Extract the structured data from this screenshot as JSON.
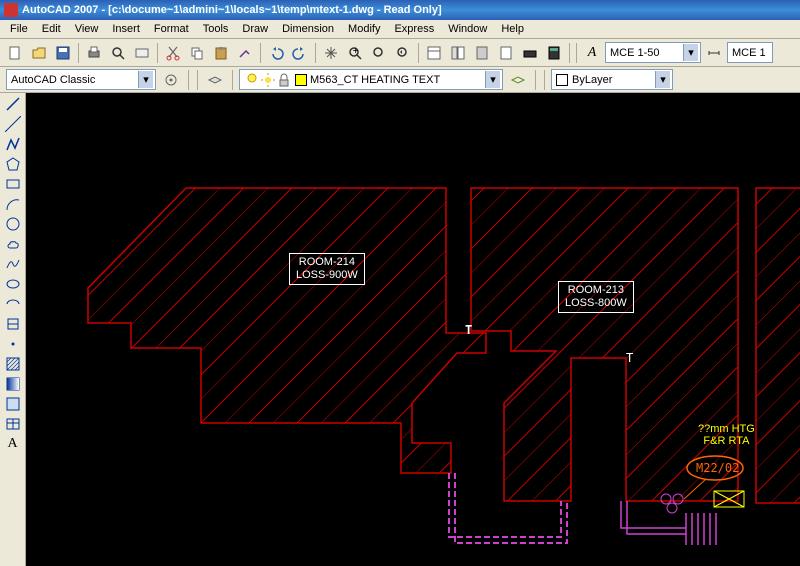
{
  "title": "AutoCAD 2007 - [c:\\docume~1\\admini~1\\locals~1\\temp\\mtext-1.dwg - Read Only]",
  "menu": [
    "File",
    "Edit",
    "View",
    "Insert",
    "Format",
    "Tools",
    "Draw",
    "Dimension",
    "Modify",
    "Express",
    "Window",
    "Help"
  ],
  "scale": {
    "label": "MCE 1-50",
    "label2": "MCE 1"
  },
  "workspace": "AutoCAD Classic",
  "layer": "M563_CT HEATING TEXT",
  "style": "ByLayer",
  "room1": {
    "name": "ROOM-214",
    "loss": "LOSS-900W"
  },
  "room2": {
    "name": "ROOM-213",
    "loss": "LOSS-800W"
  },
  "tmark": "T",
  "yellow_text": {
    "line1": "??mm HTG",
    "line2": "F&R RTA"
  },
  "tag": "M22/02",
  "left_tools": [
    "line",
    "xline",
    "pline",
    "polygon",
    "rect",
    "arc",
    "circle",
    "revcloud",
    "spline",
    "ellipse",
    "ellipse-arc",
    "block",
    "point",
    "hatch",
    "gradient",
    "region",
    "table",
    "text"
  ]
}
